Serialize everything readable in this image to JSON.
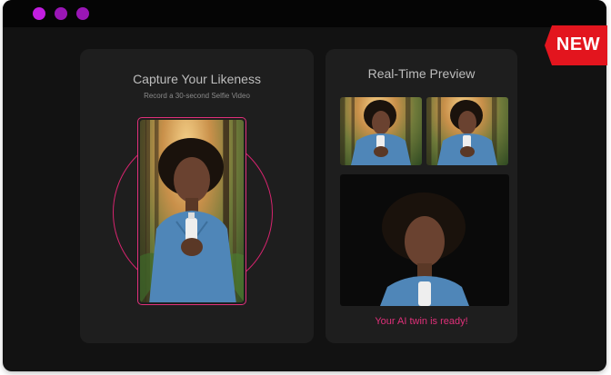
{
  "window": {
    "traffic_lights": [
      "#c21ee0",
      "#9a16b6",
      "#9a16b6"
    ]
  },
  "badge": {
    "label": "NEW",
    "color": "#e3151e"
  },
  "capture_panel": {
    "title": "Capture Your Likeness",
    "subtitle": "Record a 30-second Selfie Video",
    "accent": "#e0307a",
    "selfie_alt": "selfie-video-frame"
  },
  "preview_panel": {
    "title": "Real-Time Preview",
    "status": "Your AI twin is ready!",
    "status_color": "#e0307a"
  }
}
